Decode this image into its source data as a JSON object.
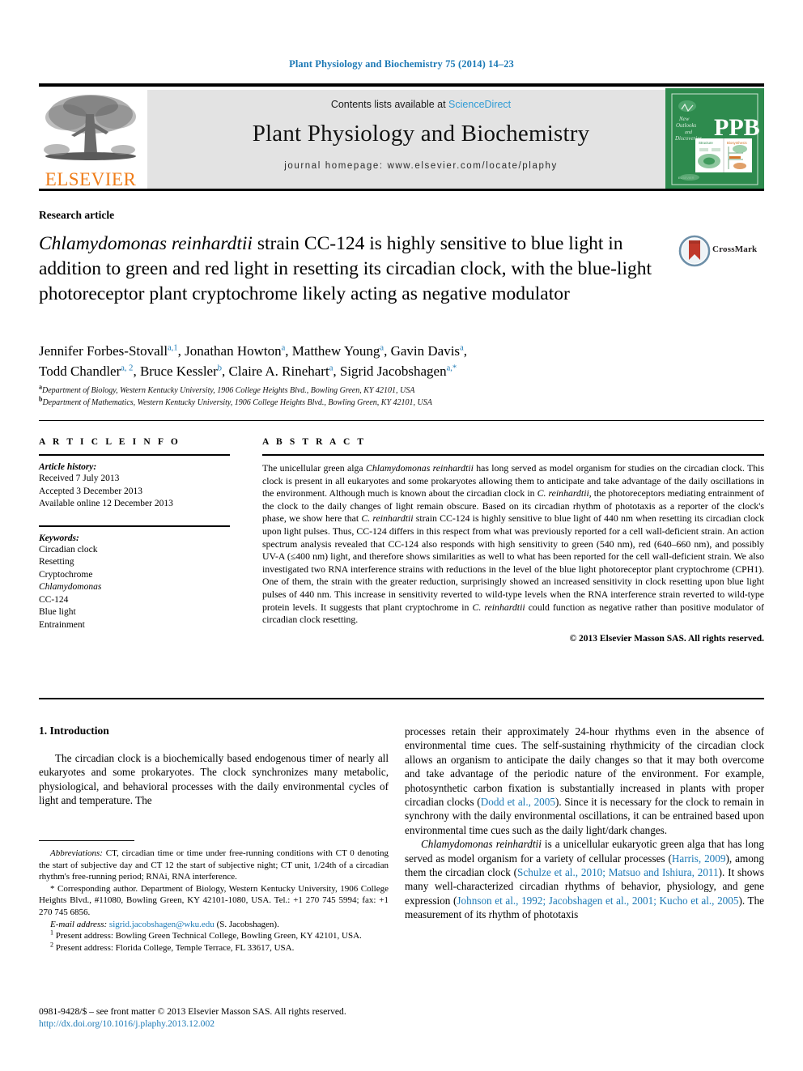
{
  "running_head": "Plant Physiology and Biochemistry 75 (2014) 14–23",
  "masthead": {
    "publisher": "ELSEVIER",
    "contents_prefix": "Contents lists available at ",
    "contents_link": "ScienceDirect",
    "journal_name": "Plant Physiology and Biochemistry",
    "homepage": "journal homepage: www.elsevier.com/locate/plaphy",
    "cover_badge": "PPB",
    "cover_tagline_1": "New",
    "cover_tagline_2": "Outlooks",
    "cover_tagline_3": "and",
    "cover_tagline_4": "Discoveries",
    "cover_panel_left": "Structure",
    "cover_panel_right": "Biosynthesis"
  },
  "article": {
    "type": "Research article",
    "title_part_1_italic": "Chlamydomonas reinhardtii",
    "title_rest": " strain CC-124 is highly sensitive to blue light in addition to green and red light in resetting its circadian clock, with the blue-light photoreceptor plant cryptochrome likely acting as negative modulator",
    "crossmark_label": "CrossMark"
  },
  "authors": {
    "line_1": "Jennifer Forbes-Stovall",
    "line_1_sup_1": "a,1",
    "a2": ", Jonathan Howton",
    "a2_sup": "a",
    "a3": ", Matthew Young",
    "a3_sup": "a",
    "a4": ", Gavin Davis",
    "a4_sup": "a",
    "a4_tail": ",",
    "b1": "Todd Chandler",
    "b1_sup": "a, 2",
    "b2": ", Bruce Kessler",
    "b2_sup": "b",
    "b3": ", Claire A. Rinehart",
    "b3_sup": "a",
    "b4": ", Sigrid Jacobshagen",
    "b4_sup": "a,*",
    "affiliation_a_sup": "a",
    "affiliation_a": "Department of Biology, Western Kentucky University, 1906 College Heights Blvd., Bowling Green, KY 42101, USA",
    "affiliation_b_sup": "b",
    "affiliation_b": "Department of Mathematics, Western Kentucky University, 1906 College Heights Blvd., Bowling Green, KY 42101, USA"
  },
  "article_info": {
    "heading": "A R T I C L E   I N F O",
    "history_label": "Article history:",
    "history": [
      "Received 7 July 2013",
      "Accepted 3 December 2013",
      "Available online 12 December 2013"
    ],
    "keywords_label": "Keywords:",
    "keywords": [
      "Circadian clock",
      "Resetting",
      "Cryptochrome",
      "Chlamydomonas",
      "CC-124",
      "Blue light",
      "Entrainment"
    ],
    "keyword_italic_index": 3
  },
  "abstract": {
    "heading": "A B S T R A C T",
    "body_1": "The unicellular green alga ",
    "body_italic_1": "Chlamydomonas reinhardtii",
    "body_2": " has long served as model organism for studies on the circadian clock. This clock is present in all eukaryotes and some prokaryotes allowing them to anticipate and take advantage of the daily oscillations in the environment. Although much is known about the circadian clock in ",
    "body_italic_2": "C. reinhardtii",
    "body_3": ", the photoreceptors mediating entrainment of the clock to the daily changes of light remain obscure. Based on its circadian rhythm of phototaxis as a reporter of the clock's phase, we show here that ",
    "body_italic_3": "C. reinhardtii",
    "body_4": " strain CC-124 is highly sensitive to blue light of 440 nm when resetting its circadian clock upon light pulses. Thus, CC-124 differs in this respect from what was previously reported for a cell wall-deficient strain. An action spectrum analysis revealed that CC-124 also responds with high sensitivity to green (540 nm), red (640–660 nm), and possibly UV-A (≤400 nm) light, and therefore shows similarities as well to what has been reported for the cell wall-deficient strain. We also investigated two RNA interference strains with reductions in the level of the blue light photoreceptor plant cryptochrome (CPH1). One of them, the strain with the greater reduction, surprisingly showed an increased sensitivity in clock resetting upon blue light pulses of 440 nm. This increase in sensitivity reverted to wild-type levels when the RNA interference strain reverted to wild-type protein levels. It suggests that plant cryptochrome in ",
    "body_italic_4": "C. reinhardtii",
    "body_5": " could function as negative rather than positive modulator of circadian clock resetting.",
    "copyright": "© 2013 Elsevier Masson SAS. All rights reserved."
  },
  "introduction": {
    "heading": "1. Introduction",
    "left_p1": "The circadian clock is a biochemically based endogenous timer of nearly all eukaryotes and some prokaryotes. The clock synchronizes many metabolic, physiological, and behavioral processes with the daily environmental cycles of light and temperature. The",
    "right_p1_a": "processes retain their approximately 24-hour rhythms even in the absence of environmental time cues. The self-sustaining rhythmicity of the circadian clock allows an organism to anticipate the daily changes so that it may both overcome and take advantage of the periodic nature of the environment. For example, photosynthetic carbon fixation is substantially increased in plants with proper circadian clocks (",
    "right_cite_1": "Dodd et al., 2005",
    "right_p1_b": "). Since it is necessary for the clock to remain in synchrony with the daily environmental oscillations, it can be entrained based upon environmental time cues such as the daily light/dark changes.",
    "right_p2_italic": "Chlamydomonas reinhardtii",
    "right_p2_a": " is a unicellular eukaryotic green alga that has long served as model organism for a variety of cellular processes (",
    "right_cite_2": "Harris, 2009",
    "right_p2_b": "), among them the circadian clock (",
    "right_cite_3": "Schulze et al., 2010; Matsuo and Ishiura, 2011",
    "right_p2_c": "). It shows many well-characterized circadian rhythms of behavior, physiology, and gene expression (",
    "right_cite_4": "Johnson et al., 1992; Jacobshagen et al., 2001; Kucho et al., 2005",
    "right_p2_d": "). The measurement of its rhythm of phototaxis"
  },
  "footnotes": {
    "abbrev_label": "Abbreviations:",
    "abbrev_text": " CT, circadian time or time under free-running conditions with CT 0 denoting the start of subjective day and CT 12 the start of subjective night; CT unit, 1/24th of a circadian rhythm's free-running period; RNAi, RNA interference.",
    "corresponding": "* Corresponding author. Department of Biology, Western Kentucky University, 1906 College Heights Blvd., #11080, Bowling Green, KY 42101-1080, USA. Tel.: +1 270 745 5994; fax: +1 270 745 6856.",
    "email_label": "E-mail address:",
    "email": "sigrid.jacobshagen@wku.edu",
    "email_tail": " (S. Jacobshagen).",
    "note_1_sup": "1",
    "note_1": " Present address: Bowling Green Technical College, Bowling Green, KY 42101, USA.",
    "note_2_sup": "2",
    "note_2": " Present address: Florida College, Temple Terrace, FL 33617, USA."
  },
  "imprint": {
    "issn_line": "0981-9428/$ – see front matter © 2013 Elsevier Masson SAS. All rights reserved.",
    "doi": "http://dx.doi.org/10.1016/j.plaphy.2013.12.002"
  },
  "colors": {
    "link_blue": "#1c79b5",
    "sciencedirect_blue": "#2e9bd6",
    "elsevier_orange": "#ef7d1a",
    "cover_green": "#2e8b4e",
    "band_grey": "#e3e3e3"
  }
}
